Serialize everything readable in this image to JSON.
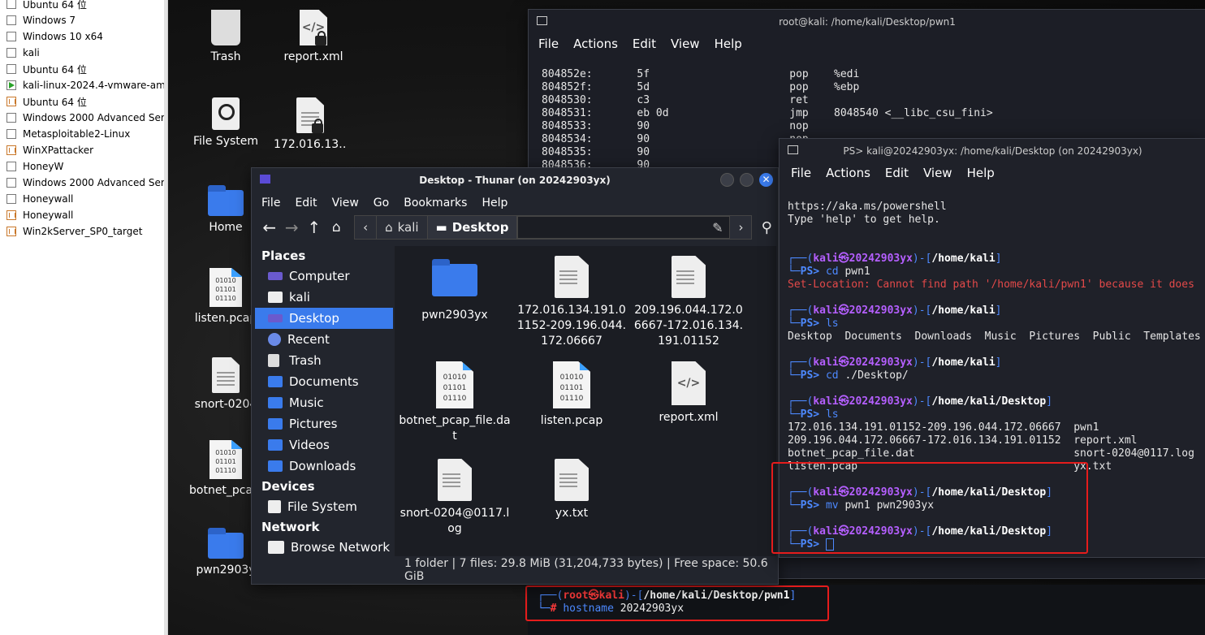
{
  "vm_list": [
    {
      "name": "Ubuntu 64 位",
      "state": "off"
    },
    {
      "name": "Windows 7",
      "state": "off"
    },
    {
      "name": "Windows 10 x64",
      "state": "off"
    },
    {
      "name": "kali",
      "state": "off"
    },
    {
      "name": "Ubuntu 64 位",
      "state": "off"
    },
    {
      "name": "kali-linux-2024.4-vmware-amd",
      "state": "running"
    },
    {
      "name": "Ubuntu 64 位",
      "state": "group"
    },
    {
      "name": "Windows 2000 Advanced Serv",
      "state": "off"
    },
    {
      "name": "Metasploitable2-Linux",
      "state": "off"
    },
    {
      "name": "WinXPattacker",
      "state": "group"
    },
    {
      "name": "HoneyW",
      "state": "off"
    },
    {
      "name": "Windows 2000 Advanced Serv",
      "state": "off"
    },
    {
      "name": "Honeywall",
      "state": "off"
    },
    {
      "name": "Honeywall",
      "state": "group"
    },
    {
      "name": "Win2kServer_SP0_target",
      "state": "group"
    }
  ],
  "desktop_icons": {
    "trash": "Trash",
    "report": "report.xml",
    "filesystem": "File System",
    "ip_file": "172.016.13…",
    "home": "Home",
    "listen": "listen.pcap",
    "snort": "snort-0204",
    "botnet": "botnet_pca…",
    "pwn": "pwn2903y"
  },
  "thunar": {
    "title": "Desktop - Thunar (on 20242903yx)",
    "menu": [
      "File",
      "Edit",
      "View",
      "Go",
      "Bookmarks",
      "Help"
    ],
    "crumbs": [
      "kali",
      "Desktop"
    ],
    "places_header": "Places",
    "places": [
      "Computer",
      "kali",
      "Desktop",
      "Recent",
      "Trash",
      "Documents",
      "Music",
      "Pictures",
      "Videos",
      "Downloads"
    ],
    "devices_header": "Devices",
    "devices": [
      "File System"
    ],
    "network_header": "Network",
    "network": [
      "Browse Network"
    ],
    "files": [
      {
        "name": "pwn2903yx",
        "kind": "folder"
      },
      {
        "name": "172.016.134.191.01152-209.196.044.172.06667",
        "kind": "doc"
      },
      {
        "name": "209.196.044.172.06667-172.016.134.191.01152",
        "kind": "doc"
      },
      {
        "name": "botnet_pcap_file.dat",
        "kind": "bin"
      },
      {
        "name": "listen.pcap",
        "kind": "bin"
      },
      {
        "name": "report.xml",
        "kind": "code"
      },
      {
        "name": "snort-0204@0117.log",
        "kind": "doc"
      },
      {
        "name": "yx.txt",
        "kind": "doc"
      }
    ],
    "status": "1 folder  |  7 files: 29.8 MiB (31,204,733 bytes)  |  Free space: 50.6 GiB"
  },
  "term_root": {
    "title": "root@kali: /home/kali/Desktop/pwn1",
    "menu": [
      "File",
      "Actions",
      "Edit",
      "View",
      "Help"
    ],
    "lines": [
      "804852e:       5f                      pop    %edi",
      "804852f:       5d                      pop    %ebp",
      "8048530:       c3                      ret",
      "8048531:       eb 0d                   jmp    8048540 <__libc_csu_fini>",
      "8048533:       90                      nop",
      "8048534:       90                      nop",
      "8048535:       90                      nop",
      "8048536:       90                      nop"
    ]
  },
  "term_ps": {
    "title": "PS> kali@20242903yx: /home/kali/Desktop (on 20242903yx)",
    "menu": [
      "File",
      "Actions",
      "Edit",
      "View",
      "Help"
    ],
    "intro1": "https://aka.ms/powershell",
    "intro2": "Type 'help' to get help.",
    "user": "kali",
    "host": "20242903yx",
    "path_home": "/home/kali",
    "path_desktop": "/home/kali/Desktop",
    "cmd1": "cd pwn1",
    "err1": "Set-Location: Cannot find path '/home/kali/pwn1' because it does",
    "cmd2": "ls",
    "ls_home": "Desktop  Documents  Downloads  Music  Pictures  Public  Templates",
    "cmd3": "cd ./Desktop/",
    "cmd4": "ls",
    "ls_desk_1a": "172.016.134.191.01152-209.196.044.172.06667",
    "ls_desk_1b": "pwn1",
    "ls_desk_2a": "209.196.044.172.06667-172.016.134.191.01152",
    "ls_desk_2b": "report.xml",
    "ls_desk_3a": "botnet_pcap_file.dat",
    "ls_desk_3b": "snort-0204@0117.log",
    "ls_desk_4a": "listen.pcap",
    "ls_desk_4b": "yx.txt",
    "cmd5": "mv pwn1 pwn2903yx",
    "ps": "PS>"
  },
  "bottom_term": {
    "user": "root",
    "host": "kali",
    "path": "/home/kali/Desktop/pwn1",
    "cmd": "hostname 20242903yx"
  },
  "colors": {
    "accent": "#3a7bec",
    "highlight": "#e51c1c",
    "prompt_user": "#b55fff",
    "prompt_frame": "#4d89ff"
  }
}
